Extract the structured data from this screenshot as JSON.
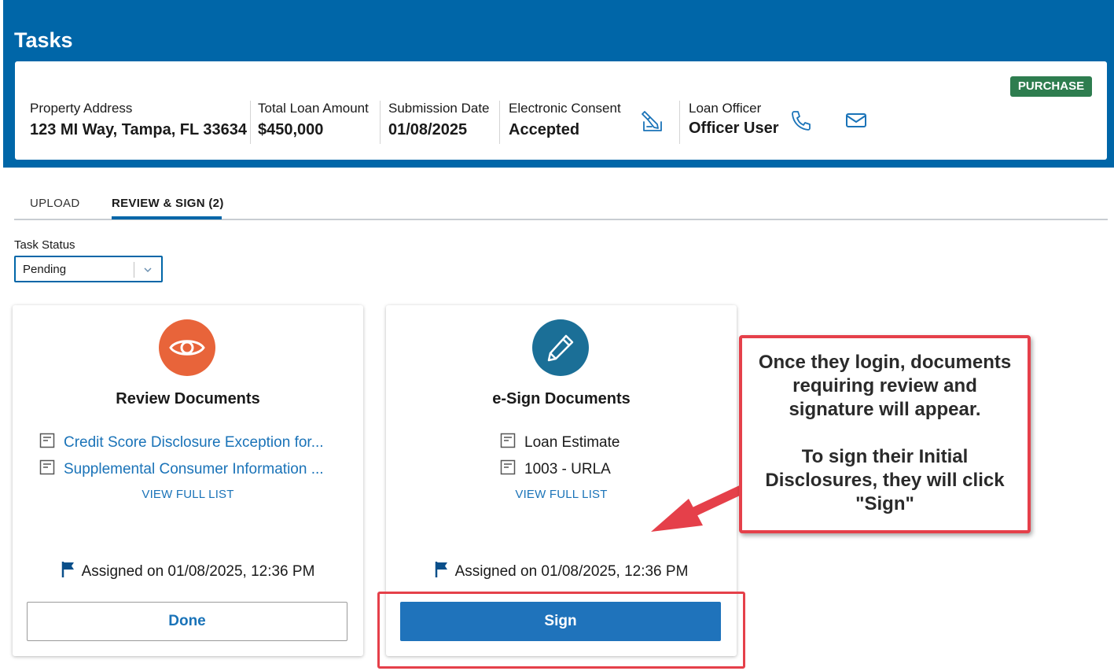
{
  "header": {
    "title": "Tasks",
    "badge": "PURCHASE",
    "fields": [
      {
        "label": "Property Address",
        "value": "123 MI Way, Tampa, FL 33634"
      },
      {
        "label": "Total Loan Amount",
        "value": "$450,000"
      },
      {
        "label": "Submission Date",
        "value": "01/08/2025"
      },
      {
        "label": "Electronic Consent",
        "value": "Accepted"
      },
      {
        "label": "Loan Officer",
        "value": "Officer User"
      }
    ],
    "icons": {
      "consent": "signature-pen-icon",
      "phone": "phone-icon",
      "email": "envelope-icon"
    }
  },
  "tabs": [
    {
      "label": "UPLOAD",
      "active": false
    },
    {
      "label": "REVIEW & SIGN (2)",
      "active": true
    }
  ],
  "task_status": {
    "label": "Task Status",
    "value": "Pending"
  },
  "cards": [
    {
      "title": "Review Documents",
      "icon": "eye-icon",
      "icon_color": "#e8643a",
      "documents": [
        "Credit Score Disclosure Exception for...",
        "Supplemental Consumer Information ..."
      ],
      "view_list": "VIEW FULL LIST",
      "assigned": "Assigned on 01/08/2025, 12:36 PM",
      "button": "Done"
    },
    {
      "title": "e-Sign Documents",
      "icon": "pencil-icon",
      "icon_color": "#1b6f97",
      "documents": [
        "Loan Estimate",
        "1003 - URLA"
      ],
      "view_list": "VIEW FULL LIST",
      "assigned": "Assigned on 01/08/2025, 12:36 PM",
      "button": "Sign"
    }
  ],
  "callout": {
    "line1": "Once they login, documents requiring review and signature will appear.",
    "line2": "To sign their Initial Disclosures, they will click \"Sign\""
  },
  "colors": {
    "header": "#0066a8",
    "badge": "#2e7d4f",
    "annotation": "#e5404a",
    "link": "#1a73b8",
    "primary_button": "#1f73bb"
  }
}
